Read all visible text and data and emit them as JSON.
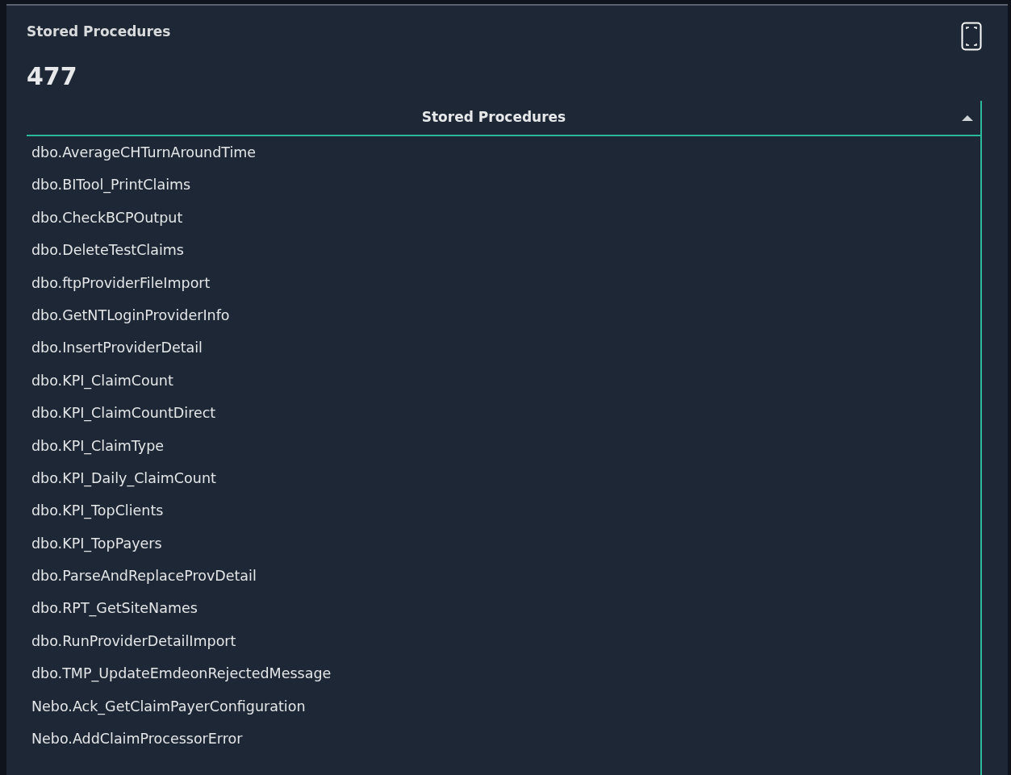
{
  "panel": {
    "title": "Stored Procedures",
    "count": "477"
  },
  "table": {
    "column": {
      "label": "Stored Procedures",
      "sorted_ascending": true
    },
    "rows": [
      "dbo.AverageCHTurnAroundTime",
      "dbo.BITool_PrintClaims",
      "dbo.CheckBCPOutput",
      "dbo.DeleteTestClaims",
      "dbo.ftpProviderFileImport",
      "dbo.GetNTLoginProviderInfo",
      "dbo.InsertProviderDetail",
      "dbo.KPI_ClaimCount",
      "dbo.KPI_ClaimCountDirect",
      "dbo.KPI_ClaimType",
      "dbo.KPI_Daily_ClaimCount",
      "dbo.KPI_TopClients",
      "dbo.KPI_TopPayers",
      "dbo.ParseAndReplaceProvDetail",
      "dbo.RPT_GetSiteNames",
      "dbo.RunProviderDetailImport",
      "dbo.TMP_UpdateEmdeonRejectedMessage",
      "Nebo.Ack_GetClaimPayerConfiguration",
      "Nebo.AddClaimProcessorError"
    ]
  }
}
